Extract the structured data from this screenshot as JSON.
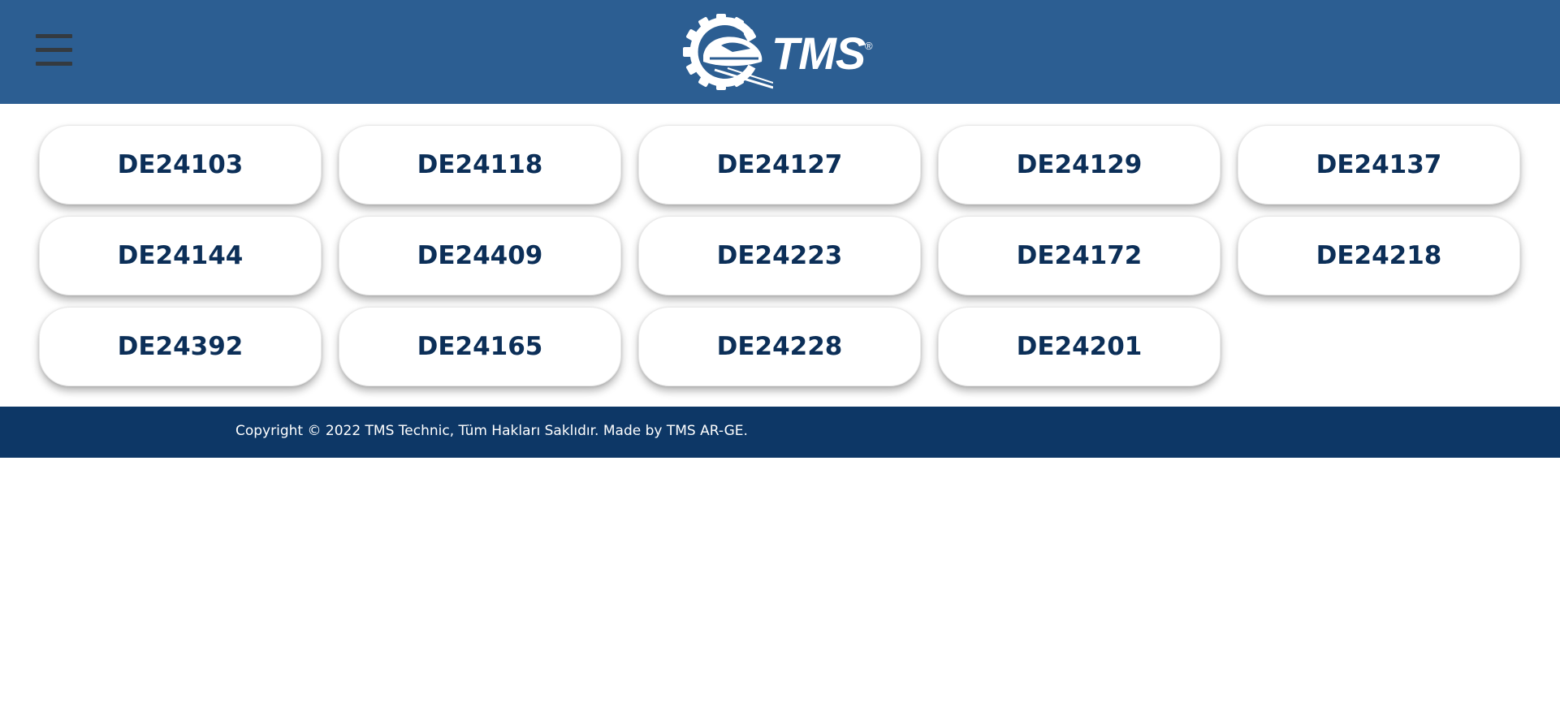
{
  "header": {
    "background_color": "#2c5e92",
    "menu_icon": "hamburger-icon",
    "logo": {
      "text": "TMS",
      "registered_mark": "®",
      "icon": "gear-train-icon"
    }
  },
  "devices": [
    "DE24103",
    "DE24118",
    "DE24127",
    "DE24129",
    "DE24137",
    "DE24144",
    "DE24409",
    "DE24223",
    "DE24172",
    "DE24218",
    "DE24392",
    "DE24165",
    "DE24228",
    "DE24201"
  ],
  "footer": {
    "background_color": "#0d3766",
    "copyright": "Copyright © 2022 TMS Technic, Tüm Hakları Saklıdır. Made by TMS AR-GE."
  },
  "colors": {
    "card_text": "#0c2f58",
    "menu_bars": "#343a40"
  }
}
